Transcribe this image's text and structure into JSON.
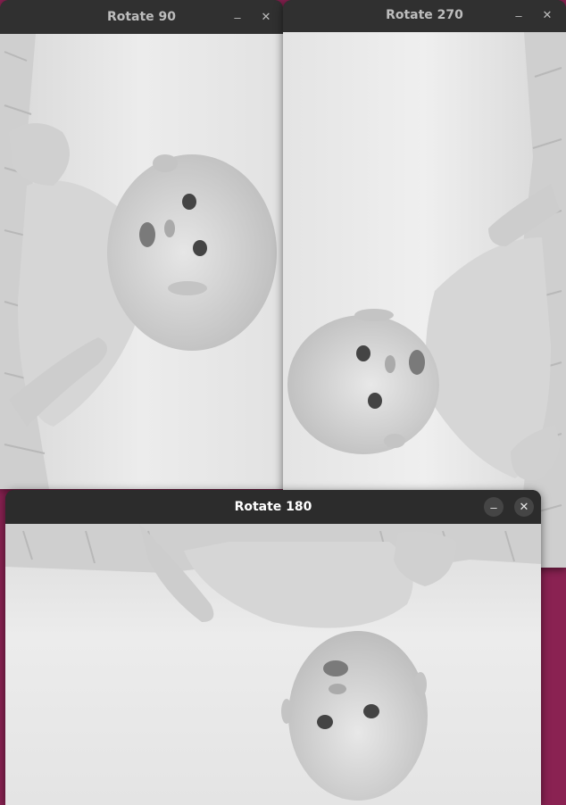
{
  "windows": [
    {
      "id": "rotate90",
      "title": "Rotate 90",
      "minimize_glyph": "–",
      "close_glyph": "✕",
      "state": "inactive",
      "rotation_degrees": 90
    },
    {
      "id": "rotate270",
      "title": "Rotate 270",
      "minimize_glyph": "–",
      "close_glyph": "✕",
      "state": "inactive",
      "rotation_degrees": 270
    },
    {
      "id": "rotate180",
      "title": "Rotate 180",
      "minimize_glyph": "–",
      "close_glyph": "✕",
      "state": "active",
      "rotation_degrees": 180
    }
  ],
  "colors": {
    "desktop": "#8a2252",
    "titlebar": "#2c2c2c",
    "photo_background": "#e6e6e6",
    "skin": "#d2d2d2",
    "blanket": "#cfcfcf"
  },
  "icons": [
    "minimize-icon",
    "close-icon"
  ]
}
